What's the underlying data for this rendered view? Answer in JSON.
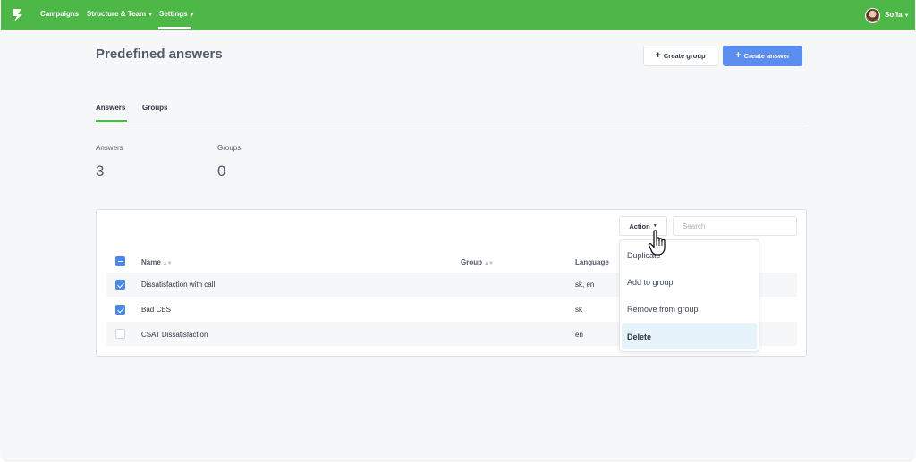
{
  "nav": {
    "items": [
      {
        "label": "Campaigns",
        "has_caret": false
      },
      {
        "label": "Structure & Team",
        "has_caret": true
      },
      {
        "label": "Settings",
        "has_caret": true
      }
    ],
    "active": "Settings",
    "user": {
      "name": "Sofia"
    }
  },
  "page": {
    "title": "Predefined answers",
    "create_group_label": "Create group",
    "create_answer_label": "Create answer"
  },
  "tabs": [
    {
      "label": "Answers",
      "active": true
    },
    {
      "label": "Groups",
      "active": false
    }
  ],
  "stats": [
    {
      "label": "Answers",
      "value": "3"
    },
    {
      "label": "Groups",
      "value": "0"
    }
  ],
  "toolbar": {
    "action_label": "Action",
    "search_placeholder": "Search"
  },
  "table": {
    "columns": [
      "Name",
      "Group",
      "Language"
    ],
    "rows": [
      {
        "checked": true,
        "name": "Dissatisfaction with call",
        "group": "",
        "language": "sk, en"
      },
      {
        "checked": true,
        "name": "Bad CES",
        "group": "",
        "language": "sk"
      },
      {
        "checked": false,
        "name": "CSAT Dissatisfaction",
        "group": "",
        "language": "en"
      }
    ]
  },
  "action_menu": {
    "items": [
      "Duplicate",
      "Add to group",
      "Remove from group",
      "Delete"
    ],
    "highlighted": "Delete"
  },
  "colors": {
    "brand_green": "#4db848",
    "primary_blue": "#5b8def",
    "checkbox_blue": "#4a88e8",
    "highlight": "#e6f3fb"
  }
}
